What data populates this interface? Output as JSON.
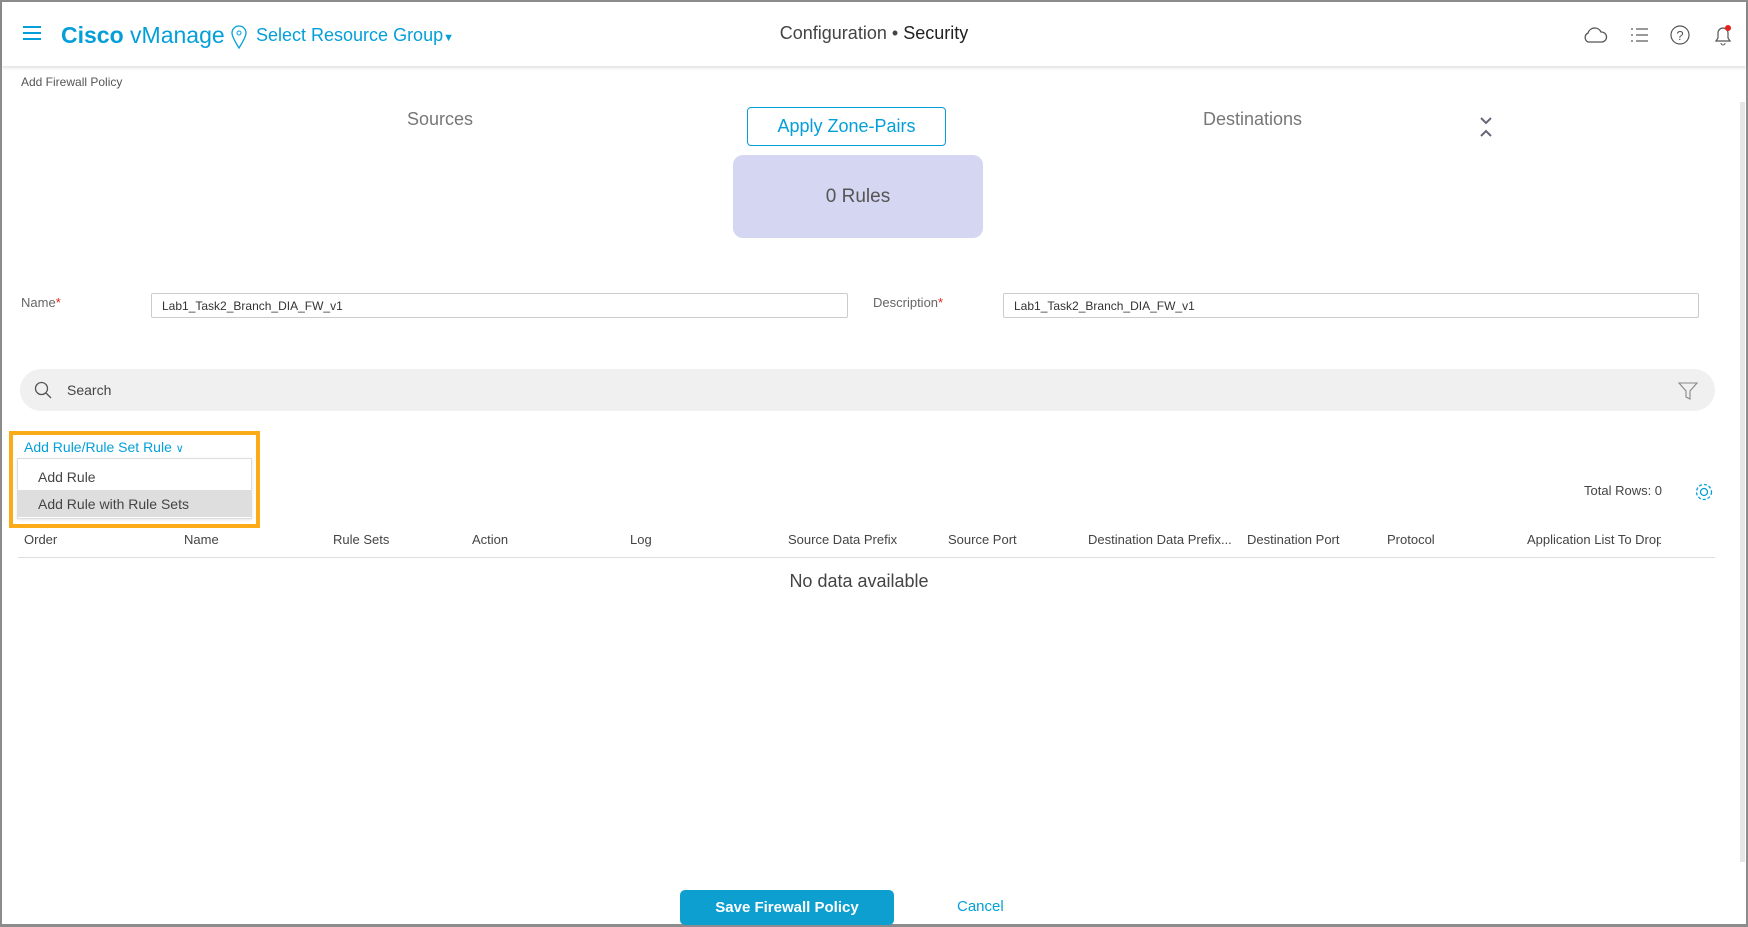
{
  "header": {
    "brand_bold": "Cisco",
    "brand_light": "vManage",
    "resource_group": "Select Resource Group",
    "title_section": "Configuration",
    "title_separator": "•",
    "title_page": "Security",
    "icons": [
      "menu-icon",
      "location-pin-icon",
      "cloud-icon",
      "list-icon",
      "help-icon",
      "bell-icon"
    ],
    "notification_dot_color": "#e2231a"
  },
  "breadcrumb": "Add Firewall Policy",
  "zone": {
    "sources": "Sources",
    "apply_zone_pairs": "Apply Zone-Pairs",
    "destinations": "Destinations",
    "rules": "0 Rules"
  },
  "form": {
    "name_label": "Name",
    "name_value": "Lab1_Task2_Branch_DIA_FW_v1",
    "description_label": "Description",
    "description_value": "Lab1_Task2_Branch_DIA_FW_v1",
    "required_mark": "*"
  },
  "search": {
    "placeholder": "Search"
  },
  "add_rule": {
    "trigger": "Add Rule/Rule Set Rule",
    "items": [
      {
        "label": "Add Rule",
        "highlighted": false
      },
      {
        "label": "Add Rule with Rule Sets",
        "highlighted": true
      }
    ],
    "highlight_color": "#fbab18"
  },
  "table": {
    "total_rows": "Total Rows: 0",
    "columns": [
      "Order",
      "Name",
      "Rule Sets",
      "Action",
      "Log",
      "Source Data Prefix",
      "Source Port",
      "Destination Data Prefix...",
      "Destination Port",
      "Protocol",
      "Application List To Drop"
    ],
    "empty": "No data available"
  },
  "footer": {
    "save": "Save Firewall Policy",
    "cancel": "Cancel"
  },
  "colors": {
    "accent": "#049fd9",
    "primary_button": "#0d9fcf",
    "rules_box": "#d5d6f2"
  }
}
